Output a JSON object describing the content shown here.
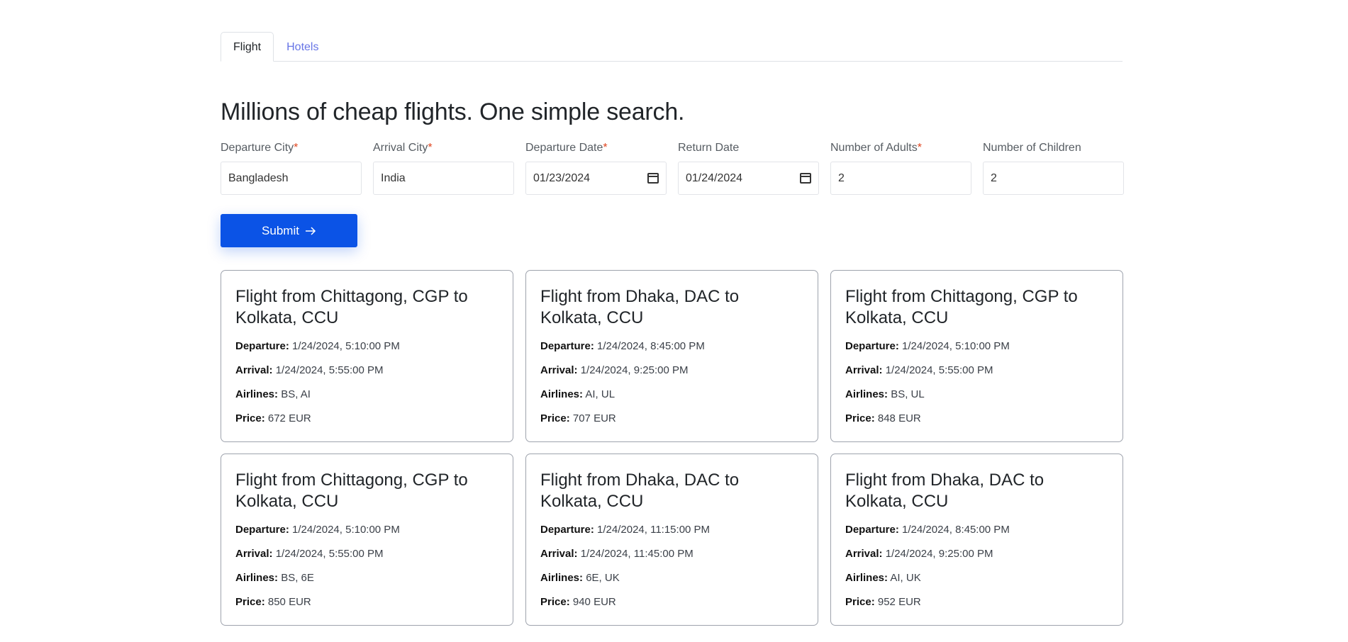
{
  "tabs": [
    {
      "label": "Flight",
      "active": true
    },
    {
      "label": "Hotels",
      "active": false
    }
  ],
  "headline": "Millions of cheap flights. One simple search.",
  "form": {
    "fields": [
      {
        "label": "Departure City",
        "required": true,
        "value": "Bangladesh"
      },
      {
        "label": "Arrival City",
        "required": true,
        "value": "India"
      },
      {
        "label": "Departure Date",
        "required": true,
        "value": "01/23/2024",
        "icon": "calendar-icon"
      },
      {
        "label": "Return Date",
        "required": false,
        "value": "01/24/2024",
        "icon": "calendar-icon"
      },
      {
        "label": "Number of Adults",
        "required": true,
        "value": "2"
      },
      {
        "label": "Number of Children",
        "required": false,
        "value": "2"
      }
    ],
    "required_mark": "*",
    "submit_label": "Submit",
    "submit_icon": "arrow-right-icon"
  },
  "labels": {
    "departure": "Departure:",
    "arrival": "Arrival:",
    "airlines": "Airlines:",
    "price": "Price:"
  },
  "results": [
    {
      "title": "Flight from Chittagong, CGP to Kolkata, CCU",
      "departure": "1/24/2024, 5:10:00 PM",
      "arrival": "1/24/2024, 5:55:00 PM",
      "airlines": "BS, AI",
      "price": "672 EUR"
    },
    {
      "title": "Flight from Dhaka, DAC to Kolkata, CCU",
      "departure": "1/24/2024, 8:45:00 PM",
      "arrival": "1/24/2024, 9:25:00 PM",
      "airlines": "AI, UL",
      "price": "707 EUR"
    },
    {
      "title": "Flight from Chittagong, CGP to Kolkata, CCU",
      "departure": "1/24/2024, 5:10:00 PM",
      "arrival": "1/24/2024, 5:55:00 PM",
      "airlines": "BS, UL",
      "price": "848 EUR"
    },
    {
      "title": "Flight from Chittagong, CGP to Kolkata, CCU",
      "departure": "1/24/2024, 5:10:00 PM",
      "arrival": "1/24/2024, 5:55:00 PM",
      "airlines": "BS, 6E",
      "price": "850 EUR"
    },
    {
      "title": "Flight from Dhaka, DAC to Kolkata, CCU",
      "departure": "1/24/2024, 11:15:00 PM",
      "arrival": "1/24/2024, 11:45:00 PM",
      "airlines": "6E, UK",
      "price": "940 EUR"
    },
    {
      "title": "Flight from Dhaka, DAC to Kolkata, CCU",
      "departure": "1/24/2024, 8:45:00 PM",
      "arrival": "1/24/2024, 9:25:00 PM",
      "airlines": "AI, UK",
      "price": "952 EUR"
    }
  ]
}
